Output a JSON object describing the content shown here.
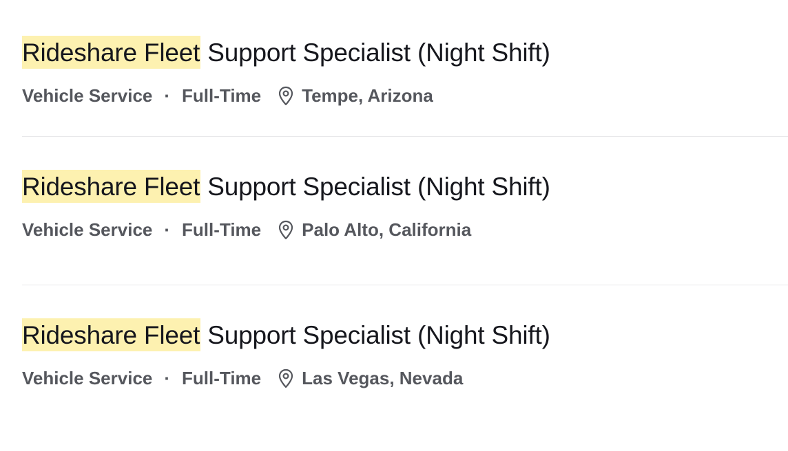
{
  "jobs": [
    {
      "title_highlight": "Rideshare Fleet",
      "title_rest": " Support Specialist (Night Shift)",
      "department": "Vehicle Service",
      "separator": "·",
      "employment_type": "Full-Time",
      "location": "Tempe, Arizona",
      "location_icon": "map-pin-icon"
    },
    {
      "title_highlight": "Rideshare Fleet",
      "title_rest": " Support Specialist (Night Shift)",
      "department": "Vehicle Service",
      "separator": "·",
      "employment_type": "Full-Time",
      "location": "Palo Alto, California",
      "location_icon": "map-pin-icon"
    },
    {
      "title_highlight": "Rideshare Fleet",
      "title_rest": " Support Specialist (Night Shift)",
      "department": "Vehicle Service",
      "separator": "·",
      "employment_type": "Full-Time",
      "location": "Las Vegas, Nevada",
      "location_icon": "map-pin-icon"
    }
  ],
  "colors": {
    "highlight": "#fdf1b0",
    "title_text": "#16171d",
    "meta_text": "#55575d",
    "divider": "#e8e8ea"
  }
}
